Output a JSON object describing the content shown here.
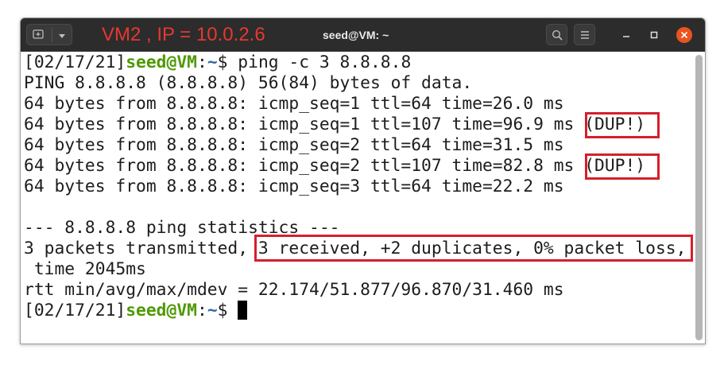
{
  "window": {
    "title": "seed@VM: ~",
    "annotation": "VM2 , IP = 10.0.2.6"
  },
  "terminal": {
    "lines": [
      {
        "prompt_date": "[02/17/21]",
        "prompt_user": "seed@VM",
        "prompt_sep": ":",
        "prompt_path": "~",
        "prompt_end": "$ ",
        "command": "ping -c 3 8.8.8.8"
      },
      {
        "text": "PING 8.8.8.8 (8.8.8.8) 56(84) bytes of data."
      },
      {
        "text": "64 bytes from 8.8.8.8: icmp_seq=1 ttl=64 time=26.0 ms"
      },
      {
        "text": "64 bytes from 8.8.8.8: icmp_seq=1 ttl=107 time=96.9 ms (DUP!)"
      },
      {
        "text": "64 bytes from 8.8.8.8: icmp_seq=2 ttl=64 time=31.5 ms"
      },
      {
        "text": "64 bytes from 8.8.8.8: icmp_seq=2 ttl=107 time=82.8 ms (DUP!)"
      },
      {
        "text": "64 bytes from 8.8.8.8: icmp_seq=3 ttl=64 time=22.2 ms"
      },
      {
        "text": ""
      },
      {
        "text": "--- 8.8.8.8 ping statistics ---"
      },
      {
        "text": "3 packets transmitted, 3 received, +2 duplicates, 0% packet loss,"
      },
      {
        "text": " time 2045ms"
      },
      {
        "text": "rtt min/avg/max/mdev = 22.174/51.877/96.870/31.460 ms"
      },
      {
        "prompt_date": "[02/17/21]",
        "prompt_user": "seed@VM",
        "prompt_sep": ":",
        "prompt_path": "~",
        "prompt_end": "$ "
      }
    ]
  },
  "colors": {
    "titlebar": "#2c2c2c",
    "annotation_red": "#e8382e",
    "highlight_box": "#d61f2c",
    "prompt_user": "#4e9a06",
    "prompt_path": "#3465a4",
    "close_button": "#e95420"
  },
  "icons": [
    "new-tab-icon",
    "menu-arrow-icon",
    "search-icon",
    "hamburger-menu-icon",
    "minimize-icon",
    "maximize-icon",
    "close-icon"
  ]
}
